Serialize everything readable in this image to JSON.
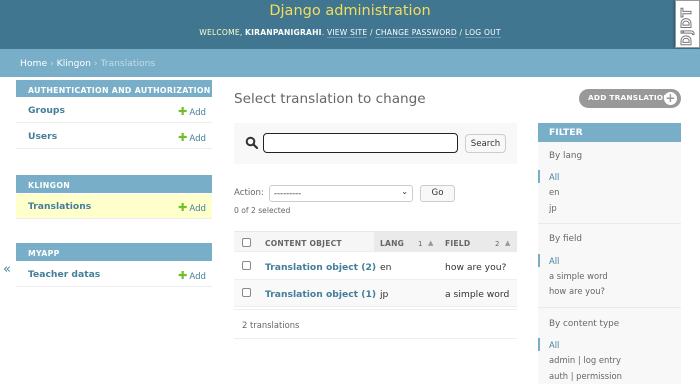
{
  "header": {
    "site_title": "Django administration",
    "welcome_prefix": "Welcome, ",
    "username": "kiranpanigrahi",
    "view_site": "View site",
    "change_password": "Change password",
    "log_out": "Log out",
    "debug_toolbar_handle": "DjDT"
  },
  "breadcrumbs": {
    "home": "Home",
    "app": "Klingon",
    "current": "Translations",
    "separator": "›"
  },
  "sidebar": {
    "add_label": "Add",
    "collapse_icon": "«",
    "modules": [
      {
        "caption": "Authentication and Authorization",
        "models": [
          {
            "name": "Groups"
          },
          {
            "name": "Users"
          }
        ]
      },
      {
        "caption": "Klingon",
        "models": [
          {
            "name": "Translations"
          }
        ]
      },
      {
        "caption": "Myapp",
        "models": [
          {
            "name": "Teacher datas"
          }
        ]
      }
    ]
  },
  "content": {
    "title": "Select translation to change",
    "add_button": "Add translation",
    "search": {
      "value": "",
      "button": "Search"
    },
    "actions": {
      "label": "Action:",
      "selected_value": "---------",
      "go": "Go",
      "selected_count": "0 of 2 selected"
    },
    "table": {
      "headers": {
        "content_object": "Content object",
        "lang": "Lang",
        "lang_sort_priority": "1",
        "field": "Field",
        "field_sort_priority": "2"
      },
      "rows": [
        {
          "content_object": "Translation object (2)",
          "lang": "en",
          "field": "how are you?"
        },
        {
          "content_object": "Translation object (1)",
          "lang": "jp",
          "field": "a simple word"
        }
      ]
    },
    "paginator": "2 translations"
  },
  "filter": {
    "title": "Filter",
    "groups": [
      {
        "heading": "By lang",
        "items": [
          "All",
          "en",
          "jp"
        ]
      },
      {
        "heading": "By field",
        "items": [
          "All",
          "a simple word",
          "how are you?"
        ]
      },
      {
        "heading": "By content type",
        "items": [
          "All",
          "admin | log entry",
          "auth | permission"
        ]
      }
    ]
  },
  "colors": {
    "header_bg": "#417690",
    "branding": "#f5dd5d",
    "breadcrumb_bg": "#79aec8",
    "link": "#447e9b",
    "add_plus": "#70bf2b",
    "current_row": "#ffffcc"
  },
  "icons": {
    "search": "search-icon",
    "add": "plus-icon",
    "add_translation": "plus-circle-icon",
    "sort_asc": "sort-ascending-icon",
    "collapse": "collapse-sidebar-icon",
    "select_chevron": "chevron-down-icon"
  }
}
